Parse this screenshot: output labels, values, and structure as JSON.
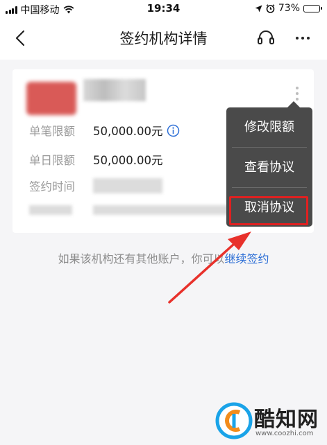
{
  "status_bar": {
    "carrier": "中国移动",
    "time": "19:34",
    "battery_text": "73%",
    "battery_level": 0.73
  },
  "nav": {
    "title": "签约机构详情",
    "back_icon": "chevron-left-icon",
    "support_icon": "headset-icon",
    "more_icon": "more-horizontal-icon"
  },
  "card": {
    "rows": [
      {
        "label": "单笔限额",
        "value": "50,000.00元"
      },
      {
        "label": "单日限额",
        "value": "50,000.00元"
      },
      {
        "label": "签约时间",
        "value": ""
      }
    ]
  },
  "menu": {
    "items": [
      "修改限额",
      "查看协议",
      "取消协议"
    ],
    "highlight_color": "#e02020"
  },
  "hint": {
    "text": "如果该机构还有其他账户，你可以",
    "link": "继续签约"
  },
  "watermark": {
    "text": "酷知网",
    "url": "www.coozhi.com"
  },
  "colors": {
    "accent": "#2d6fd6",
    "arrow": "#e8312b",
    "menu_bg": "#4a4a4a"
  }
}
